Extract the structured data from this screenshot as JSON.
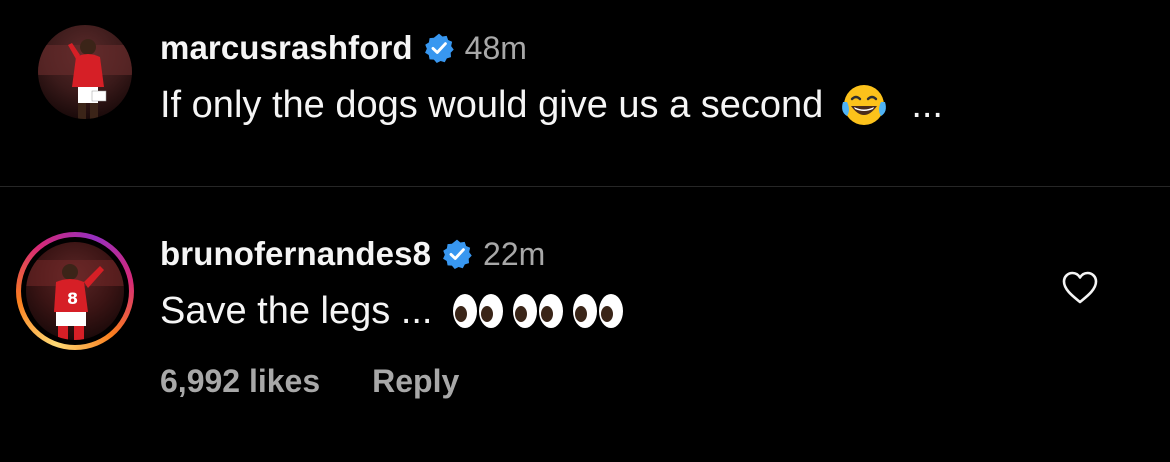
{
  "comments": [
    {
      "username": "marcusrashford",
      "verified": true,
      "timestamp": "48m",
      "text": "If only the dogs would give us a second",
      "emoji": "laughing-tears",
      "trailing": "..."
    },
    {
      "username": "brunofernandes8",
      "verified": true,
      "timestamp": "22m",
      "text": "Save the legs ...",
      "emoji": "eyes x3",
      "likes": "6,992 likes",
      "reply_label": "Reply",
      "story_ring": true
    }
  ],
  "colors": {
    "background": "#000000",
    "text": "#f5f5f5",
    "muted": "#a8a8a8",
    "verified": "#3897f0",
    "divider": "#262626"
  },
  "icons": [
    "verified-badge-icon",
    "laughing-tears-emoji",
    "eyes-emoji",
    "heart-outline-icon"
  ]
}
